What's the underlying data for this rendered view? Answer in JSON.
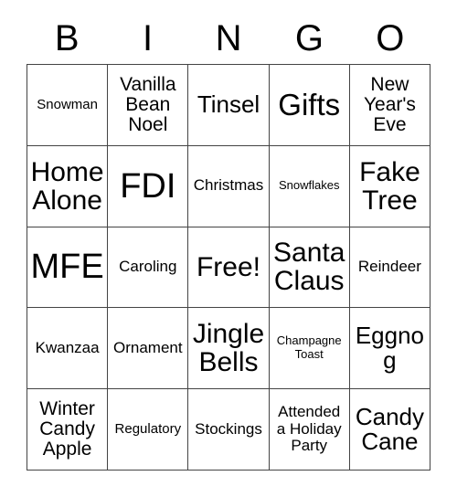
{
  "card": {
    "title_letters": [
      "B",
      "I",
      "N",
      "G",
      "O"
    ],
    "columns": 5,
    "rows": 5,
    "grid_line_color": "#444444",
    "background_color": "#ffffff",
    "text_color": "#000000",
    "free_space": "Free!",
    "cells": [
      [
        {
          "label": "Snowman",
          "size": "sm"
        },
        {
          "label": "Vanilla Bean Noel",
          "size": "lg"
        },
        {
          "label": "Tinsel",
          "size": "xl"
        },
        {
          "label": "Gifts",
          "size": "3xl"
        },
        {
          "label": "New Year's Eve",
          "size": "lg"
        }
      ],
      [
        {
          "label": "Home Alone",
          "size": "2xl"
        },
        {
          "label": "FDI",
          "size": "4xl"
        },
        {
          "label": "Christmas",
          "size": "md"
        },
        {
          "label": "Snowflakes",
          "size": "xs"
        },
        {
          "label": "Fake Tree",
          "size": "2xl"
        }
      ],
      [
        {
          "label": "MFE",
          "size": "4xl"
        },
        {
          "label": "Caroling",
          "size": "md"
        },
        {
          "label": "Free!",
          "size": "2xl"
        },
        {
          "label": "Santa Claus",
          "size": "2xl"
        },
        {
          "label": "Reindeer",
          "size": "md"
        }
      ],
      [
        {
          "label": "Kwanzaa",
          "size": "md"
        },
        {
          "label": "Ornament",
          "size": "md"
        },
        {
          "label": "Jingle Bells",
          "size": "2xl"
        },
        {
          "label": "Champagne Toast",
          "size": "xs"
        },
        {
          "label": "Eggnog",
          "size": "xl"
        }
      ],
      [
        {
          "label": "Winter Candy Apple",
          "size": "lg"
        },
        {
          "label": "Regulatory",
          "size": "sm"
        },
        {
          "label": "Stockings",
          "size": "md"
        },
        {
          "label": "Attended a Holiday Party",
          "size": "md"
        },
        {
          "label": "Candy Cane",
          "size": "xl"
        }
      ]
    ]
  }
}
